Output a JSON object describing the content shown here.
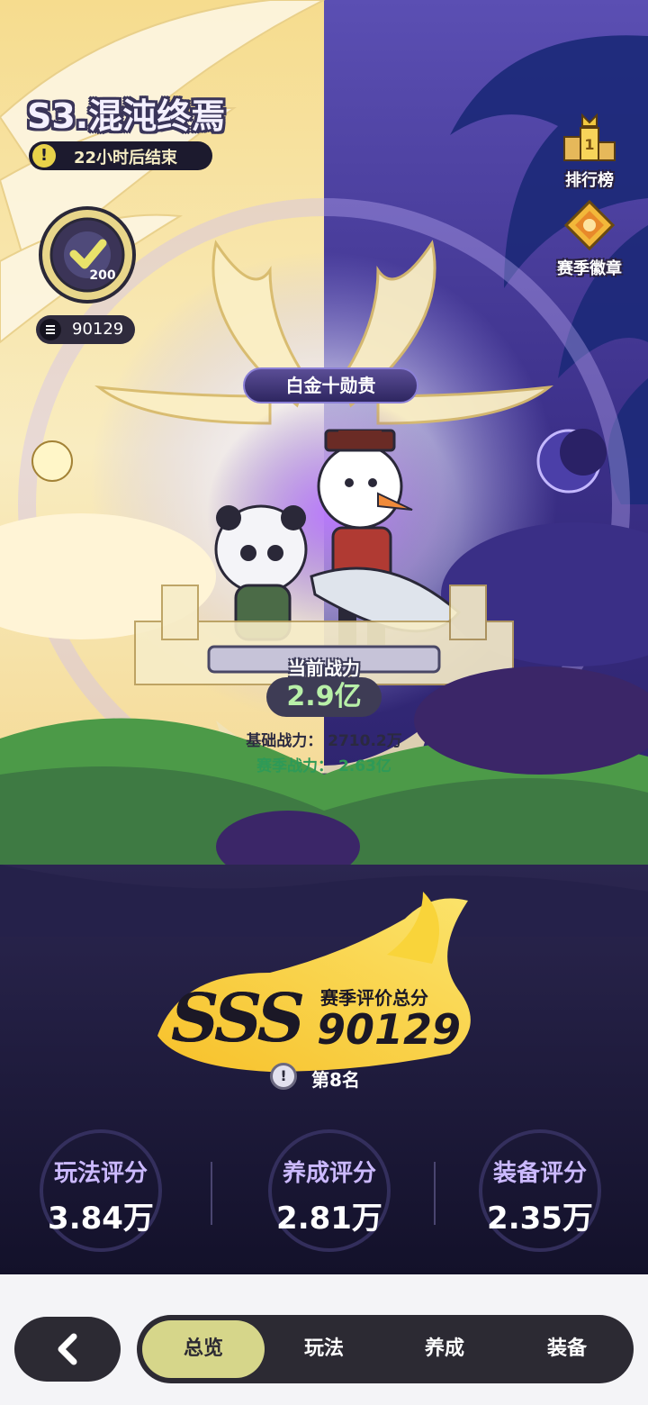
{
  "season": {
    "title": "S3.混沌终焉",
    "timer_text": "22小时后结束"
  },
  "player": {
    "level_badge_value": "200",
    "points": "90129"
  },
  "side_menu": {
    "leaderboard_label": "排行榜",
    "leaderboard_icon": "podium-trophy-icon",
    "badge_label": "赛季徽章",
    "badge_icon": "season-medal-icon"
  },
  "rank_banner": "白金十勋贵",
  "power": {
    "current_label": "当前战力",
    "current_value": "2.9亿",
    "base_text": "基础战力： 2710.2万",
    "season_text": "赛季战力： 2.63亿"
  },
  "season_rating": {
    "grade": "SSS",
    "label": "赛季评价总分",
    "score": "90129",
    "rank_text": "第8名"
  },
  "scores": [
    {
      "title": "玩法评分",
      "value": "3.84万"
    },
    {
      "title": "养成评分",
      "value": "2.81万"
    },
    {
      "title": "装备评分",
      "value": "2.35万"
    }
  ],
  "nav": {
    "back_icon": "chevron-left-icon",
    "tabs": [
      {
        "label": "总览",
        "active": true
      },
      {
        "label": "玩法",
        "active": false
      },
      {
        "label": "养成",
        "active": false
      },
      {
        "label": "装备",
        "active": false
      }
    ]
  },
  "colors": {
    "accent_tab": "#d6d68a",
    "power_value": "#b8f0a8",
    "season_power": "#2e9a57",
    "score_title": "#cbb9ff"
  }
}
